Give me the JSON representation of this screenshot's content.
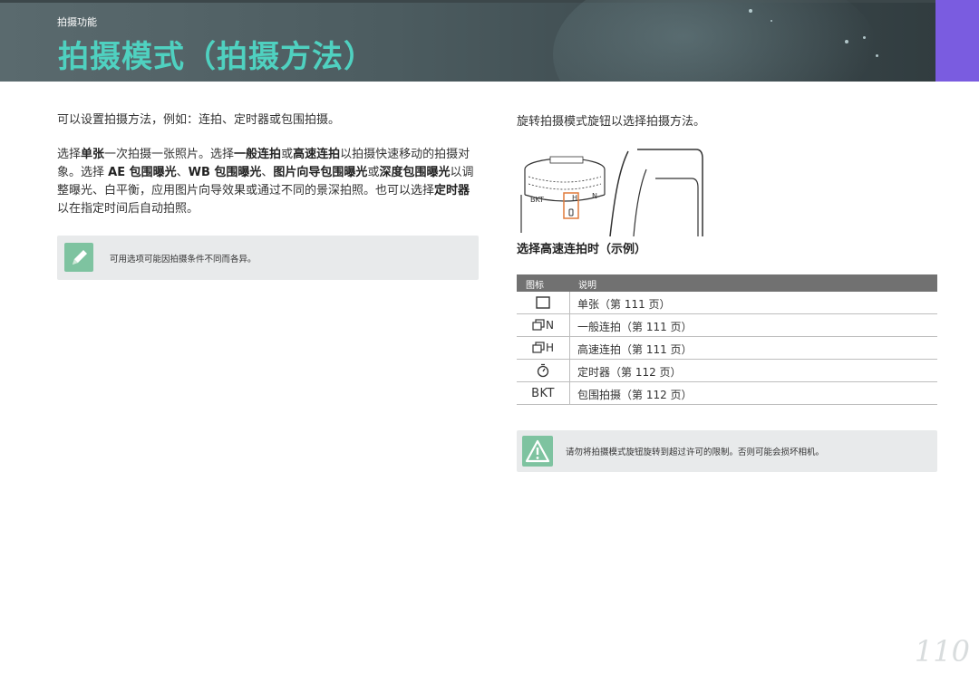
{
  "header": {
    "section_label": "拍摄功能",
    "title": "拍摄模式（拍摄方法）"
  },
  "left": {
    "intro": "可以设置拍摄方法，例如：连拍、定时器或包围拍摄。",
    "body_segments": [
      {
        "text": "选择",
        "bold": false
      },
      {
        "text": "单张",
        "bold": true
      },
      {
        "text": "一次拍摄一张照片。选择",
        "bold": false
      },
      {
        "text": "一般连拍",
        "bold": true
      },
      {
        "text": "或",
        "bold": false
      },
      {
        "text": "高速连拍",
        "bold": true
      },
      {
        "text": "以拍摄快速移动的拍摄对象。选择 ",
        "bold": false
      },
      {
        "text": "AE 包围曝光",
        "bold": true
      },
      {
        "text": "、",
        "bold": false
      },
      {
        "text": "WB 包围曝光",
        "bold": true
      },
      {
        "text": "、",
        "bold": false
      },
      {
        "text": "图片向导包围曝光",
        "bold": true
      },
      {
        "text": "或",
        "bold": false
      },
      {
        "text": "深度包围曝光",
        "bold": true
      },
      {
        "text": "以调整曝光、白平衡，应用图片向导效果或通过不同的景深拍照。也可以选择",
        "bold": false
      },
      {
        "text": "定时器",
        "bold": true
      },
      {
        "text": "以在指定时间后自动拍照。",
        "bold": false
      }
    ],
    "note": "可用选项可能因拍摄条件不同而各异。"
  },
  "right": {
    "intro": "旋转拍摄模式旋钮以选择拍摄方法。",
    "dial_labels": [
      "BKT",
      "H",
      "N"
    ],
    "subhead": "选择高速连拍时（示例）",
    "table": {
      "headers": [
        "图标",
        "说明"
      ],
      "rows": [
        {
          "icon": "single-frame-icon",
          "label": "",
          "desc": "单张（第 111 页）"
        },
        {
          "icon": "continuous-n-icon",
          "label": "N",
          "desc": "一般连拍（第 111 页）"
        },
        {
          "icon": "continuous-h-icon",
          "label": "H",
          "desc": "高速连拍（第 111 页）"
        },
        {
          "icon": "timer-icon",
          "label": "",
          "desc": "定时器（第 112 页）"
        },
        {
          "icon": "bkt-icon",
          "label": "BKT",
          "desc": "包围拍摄（第 112 页）"
        }
      ]
    },
    "warning": "请勿将拍摄模式旋钮旋转到超过许可的限制。否则可能会损坏相机。"
  },
  "page_number": "110",
  "colors": {
    "title": "#4fd1c0",
    "accent_tab": "#7a5ce0",
    "icon_bg": "#7ec3a0"
  }
}
